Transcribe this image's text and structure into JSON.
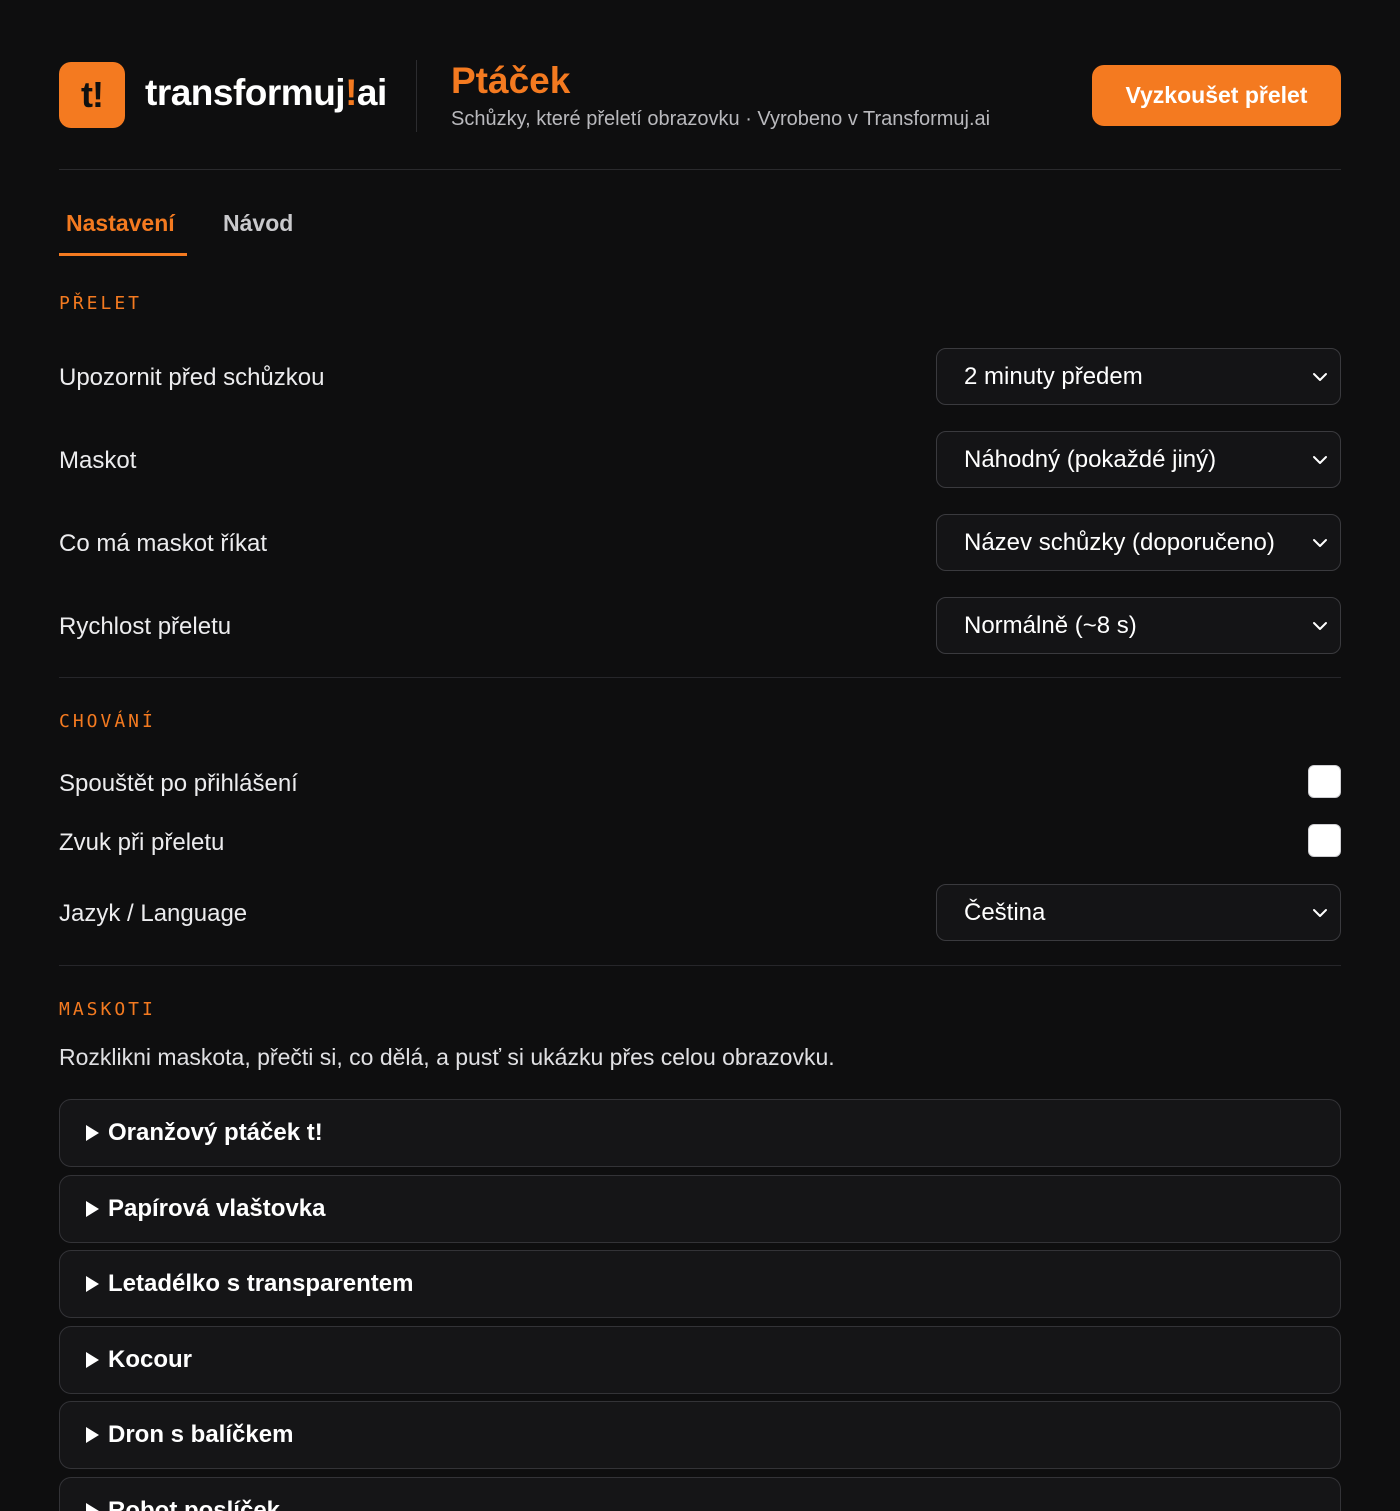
{
  "brand": {
    "mark": "t!",
    "name_main": "transformuj",
    "name_bang": "!",
    "name_suffix": "ai"
  },
  "app": {
    "title": "Ptáček",
    "subtitle": "Schůzky, které přeletí obrazovku · Vyrobeno v Transformuj.ai"
  },
  "cta_label": "Vyzkoušet přelet",
  "tabs": [
    {
      "label": "Nastavení",
      "active": true
    },
    {
      "label": "Návod",
      "active": false
    }
  ],
  "flight": {
    "heading": "PŘELET",
    "rows": [
      {
        "label": "Upozornit před schůzkou",
        "value": "2 minuty předem"
      },
      {
        "label": "Maskot",
        "value": "Náhodný (pokaždé jiný)"
      },
      {
        "label": "Co má maskot říkat",
        "value": "Název schůzky (doporučeno)"
      },
      {
        "label": "Rychlost přeletu",
        "value": "Normálně (~8 s)"
      }
    ]
  },
  "behavior": {
    "heading": "CHOVÁNÍ",
    "launch_on_login": {
      "label": "Spouštět po přihlášení",
      "checked": false
    },
    "sound": {
      "label": "Zvuk při přeletu",
      "checked": false
    },
    "language": {
      "label": "Jazyk / Language",
      "value": "Čeština"
    }
  },
  "mascots": {
    "heading": "MASKOTI",
    "description": "Rozklikni maskota, přečti si, co dělá, a pusť si ukázku přes celou obrazovku.",
    "items": [
      "Oranžový ptáček t!",
      "Papírová vlaštovka",
      "Letadélko s transparentem",
      "Kocour",
      "Dron s balíčkem",
      "Robot poslíček"
    ]
  },
  "colors": {
    "accent": "#f47a20",
    "background": "#0e0e0f",
    "panel": "#151517"
  }
}
